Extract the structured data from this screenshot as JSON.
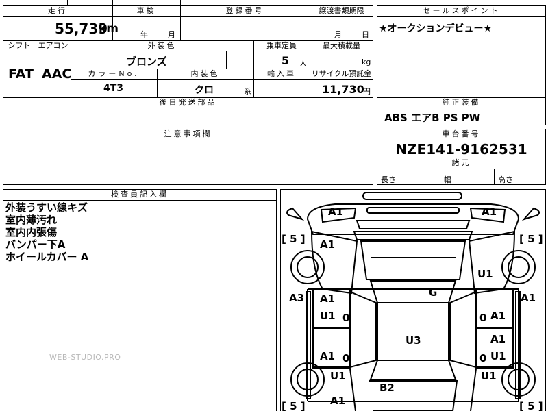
{
  "top_row": {
    "headers": {
      "mileage": "走行",
      "shaken": "車検",
      "reg_number": "登録番号",
      "transfer_deadline": "譲渡書類期限",
      "sales_point": "セールスポイント"
    },
    "mileage_value": "55,739",
    "mileage_unit": "km",
    "shaken_year": "年",
    "shaken_month": "月",
    "transfer_month": "月",
    "transfer_day": "日",
    "sales_point_text": "★オークションデビュー★"
  },
  "row2": {
    "headers": {
      "shift": "シフト",
      "aircon": "エアコン",
      "exterior_color": "外装色",
      "capacity": "乗車定員",
      "max_load": "最大積載量"
    },
    "shift_value": "FAT",
    "aircon_value": "AAC",
    "exterior_color_value": "ブロンズ",
    "capacity_value": "5",
    "capacity_unit": "人",
    "max_load_unit": "kg",
    "sub_headers": {
      "color_no": "カラーNo.",
      "interior_color": "内装色",
      "import_car": "輸入車",
      "recycle_fee": "リサイクル預託金"
    },
    "color_no_value": "4T3",
    "interior_color_value": "クロ",
    "interior_suffix": "系",
    "recycle_fee_value": "11,730",
    "recycle_fee_unit": "円"
  },
  "later_parts": {
    "header": "後日発送部品"
  },
  "equipment": {
    "header": "純正装備",
    "value": "ABS エアB PS PW"
  },
  "notes": {
    "header": "注意事項欄"
  },
  "chassis": {
    "header": "車台番号",
    "value": "NZE141-9162531"
  },
  "dimensions": {
    "header": "諸元",
    "length": "長さ",
    "width": "幅",
    "height": "高さ"
  },
  "inspector": {
    "header": "検査員記入欄",
    "lines": [
      "外装うすい線キズ",
      "室内薄汚れ",
      "室内内張傷",
      "バンパー下A",
      "ホイールカバー A"
    ]
  },
  "watermark": "WEB-STUDIO.PRO",
  "diagram_marks": {
    "front_left": "A1",
    "front_right": "A1",
    "tire_fl": "[ 5 ]",
    "tire_fr": "[ 5 ]",
    "fender_l": "A1",
    "fender_r": "U1",
    "hood": "G",
    "side_l": "A3",
    "side_r": "A1",
    "door_fl_1": "A1",
    "door_fl_2": "U1",
    "door_fl_dot": "0",
    "door_fr_dot": "0",
    "door_fr": "A1",
    "roof": "U3",
    "door_rr_1": "A1",
    "door_rr_dot": "0",
    "door_rr_2": "U1",
    "door_rl_1": "A1",
    "door_rl_dot": "0",
    "quarter_l": "U1",
    "quarter_r": "U1",
    "trunk": "B2",
    "rear_l": "A1",
    "tire_rl": "[ 5 ]",
    "tire_rr": "[ 5 ]"
  }
}
